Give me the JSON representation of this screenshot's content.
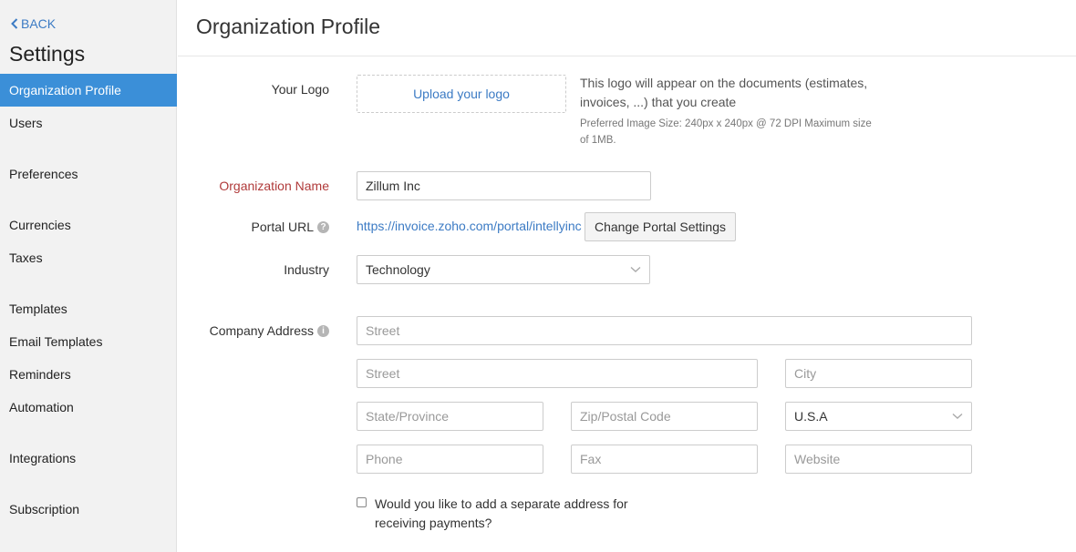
{
  "sidebar": {
    "back_label": "BACK",
    "title": "Settings",
    "items": [
      {
        "label": "Organization Profile",
        "active": true
      },
      {
        "label": "Users"
      },
      {
        "label": "Preferences"
      },
      {
        "label": "Currencies"
      },
      {
        "label": "Taxes"
      },
      {
        "label": "Templates"
      },
      {
        "label": "Email Templates"
      },
      {
        "label": "Reminders"
      },
      {
        "label": "Automation"
      },
      {
        "label": "Integrations"
      },
      {
        "label": "Subscription"
      }
    ]
  },
  "page": {
    "title": "Organization Profile"
  },
  "logo": {
    "label": "Your Logo",
    "upload_label": "Upload your logo",
    "description": "This logo will appear on the documents (estimates, invoices, ...) that you create",
    "hint": "Preferred Image Size: 240px x 240px @ 72 DPI Maximum size of 1MB."
  },
  "org_name": {
    "label": "Organization Name",
    "value": "Zillum Inc"
  },
  "portal": {
    "label": "Portal URL",
    "url": "https://invoice.zoho.com/portal/intellyinc",
    "button_label": "Change Portal Settings"
  },
  "industry": {
    "label": "Industry",
    "value": "Technology"
  },
  "address": {
    "label": "Company Address",
    "street1_placeholder": "Street",
    "street2_placeholder": "Street",
    "city_placeholder": "City",
    "state_placeholder": "State/Province",
    "zip_placeholder": "Zip/Postal Code",
    "country_value": "U.S.A",
    "phone_placeholder": "Phone",
    "fax_placeholder": "Fax",
    "website_placeholder": "Website"
  },
  "payment_address": {
    "label": "Would you like to add a separate address for receiving payments?"
  },
  "colors": {
    "accent": "#3b8fd8",
    "link": "#3c7bc4",
    "required": "#b03a3a"
  },
  "icons": {
    "back": "chevron-left-icon",
    "help": "question-circle-icon",
    "info": "info-circle-icon",
    "dropdown": "chevron-down-icon"
  }
}
